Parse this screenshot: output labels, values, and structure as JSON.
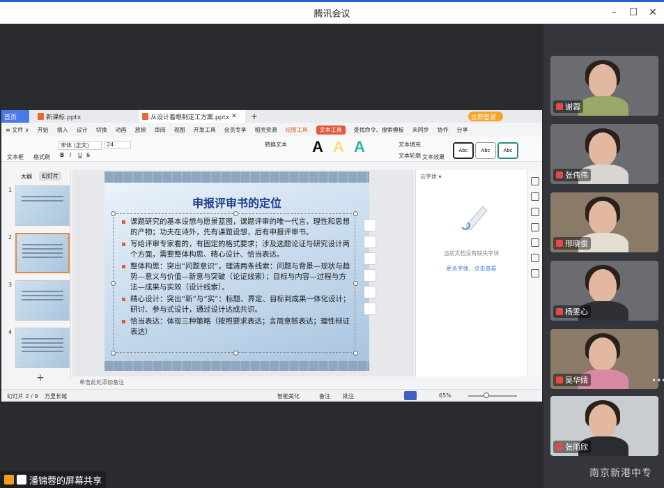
{
  "window": {
    "title": "腾讯会议"
  },
  "sidebar": {
    "participants": [
      {
        "name": "谢蓉",
        "shirt": "#9aa86a"
      },
      {
        "name": "张伟伟",
        "shirt": "#d9d5cf"
      },
      {
        "name": "邢晓俊",
        "shirt": "#e4ddd4"
      },
      {
        "name": "杨雯心",
        "shirt": "#2f2f36"
      },
      {
        "name": "吴华婧",
        "shirt": "#d98aa3"
      },
      {
        "name": "张雨欣",
        "shirt": "#2c2c30"
      }
    ],
    "more": "•••",
    "watermark": "南京新港中专"
  },
  "share_badge": {
    "label": "潘锦蓉的屏幕共享"
  },
  "wps": {
    "tabs": [
      {
        "label": "首页"
      },
      {
        "label": "新课标.pptx"
      },
      {
        "label": "从设计着眼制定工方案.pptx"
      }
    ],
    "tab_add": "+",
    "login": "立即登录",
    "menu": {
      "file": "≡ 文件 ∨",
      "items": [
        "开始",
        "插入",
        "设计",
        "切换",
        "动画",
        "放映",
        "审阅",
        "视图",
        "开发工具",
        "会员专享",
        "稻壳资源"
      ],
      "drawing_tools": "绘图工具",
      "text_tools": "文本工具",
      "search": "查找命令、搜索模板",
      "unsynced": "未同步",
      "collab": "协作",
      "share": "分享"
    },
    "ribbon": {
      "textbox": "文本框",
      "format_painter": "格式刷",
      "font_name": "宋体 (正文)",
      "font_size": "24",
      "text_fill": "文本填充",
      "text_outline": "文本轮廓",
      "text_effect": "文本效果",
      "convert_art": "转换文本",
      "arrange": "排列",
      "style_a": "A",
      "style_abc": "Abc"
    },
    "panel_tabs": {
      "outline": "大纲",
      "slides": "幻灯片"
    },
    "thumb_numbers": [
      "1",
      "2",
      "3",
      "4"
    ],
    "add_slide": "+",
    "slide": {
      "title": "申报评审书的定位",
      "bullets": [
        "课题研究的基本设想与愿景蓝图，课题评审的唯一代言，理性和思想的产物；功夫在诗外，先有课题设想，后有申报评审书。",
        "写给评审专家看的，有固定的格式要求；涉及选题论证与研究设计两个方面，需要整体构思、精心设计、恰当表达。",
        "整体构思：突出“问题意识”，理清两条线索：问题与背景—现状与趋势—意义与价值—新意与突破（论证线索）；目标与内容—过程与方法—成果与实效（设计线索）。",
        "精心设计：突出“新”与“实”：标题、界定、目标到成果一体化设计；研讨、参与式设计，通过设计达成共识。",
        "恰当表达：体现三种策略（按照要求表达；言简意赅表达；理性辩证表达）"
      ]
    },
    "font_panel": {
      "title": "云字体 ▾",
      "message": "当前文档没有缺失字体",
      "link": "更多字体，点击查看"
    },
    "notes_placeholder": "单击此处添加备注",
    "status": {
      "slide_counter": "幻灯片 2 / 9",
      "theme": "万里长城",
      "smart_beautify": "智能美化",
      "notes": "备注",
      "comments": "批注",
      "zoom": "65%"
    }
  }
}
